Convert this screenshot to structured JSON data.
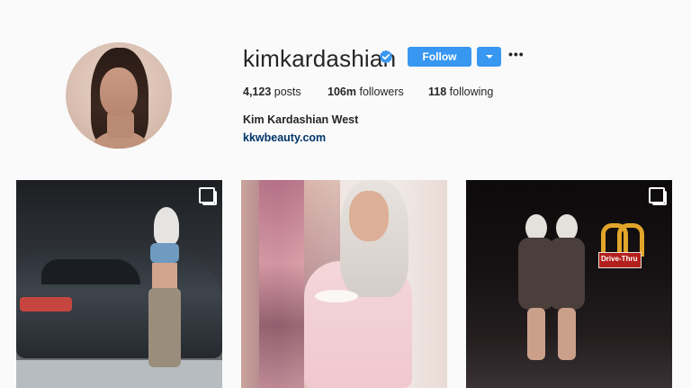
{
  "profile": {
    "username": "kimkardashian",
    "verified": true,
    "follow_label": "Follow",
    "more_label": "•••",
    "stats": {
      "posts_count": "4,123",
      "posts_label": "posts",
      "followers_count": "106m",
      "followers_label": "followers",
      "following_count": "118",
      "following_label": "following"
    },
    "full_name": "Kim Kardashian West",
    "website": "kkwbeauty.com"
  },
  "posts": [
    {
      "type": "carousel"
    },
    {
      "type": "single"
    },
    {
      "type": "carousel",
      "sign_text": "Drive-Thru"
    }
  ],
  "colors": {
    "accent": "#3897f0",
    "background": "#fafafa",
    "text": "#262626",
    "link": "#003569"
  },
  "icons": {
    "verified": "verified-badge-icon",
    "dropdown": "chevron-down-icon",
    "more": "ellipsis-icon",
    "carousel": "multiple-photos-icon"
  }
}
